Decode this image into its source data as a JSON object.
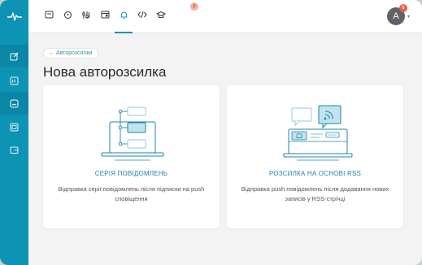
{
  "icons": {
    "logo": "pulse-logo-icon",
    "sidebar": [
      "edit-icon",
      "list-icon",
      "message-icon",
      "newsletter-icon",
      "wallet-icon"
    ],
    "topbar": [
      "mail-icon",
      "chat-icon",
      "settings-icon",
      "browser-icon",
      "bell-icon",
      "code-icon",
      "graduation-cap-icon"
    ]
  },
  "topbar": {
    "beta_badge": "β",
    "avatar_letter": "A",
    "notifications_count": "6"
  },
  "breadcrumb": {
    "back_label": "← Авторозсилки"
  },
  "page": {
    "title": "Нова авторозсилка"
  },
  "cards": [
    {
      "title": "СЕРІЯ ПОВІДОМЛЕНЬ",
      "description": "Відправка серії повідомлень після підписки на push сповіщення"
    },
    {
      "title": "РОЗСИЛКА НА ОСНОВІ RSS",
      "description": "Відправка push повідомлень після додавання нових записів у RSS-стрічці"
    }
  ],
  "colors": {
    "accent": "#0d93b4",
    "title_blue": "#1f86a8",
    "badge": "#e8604c"
  }
}
